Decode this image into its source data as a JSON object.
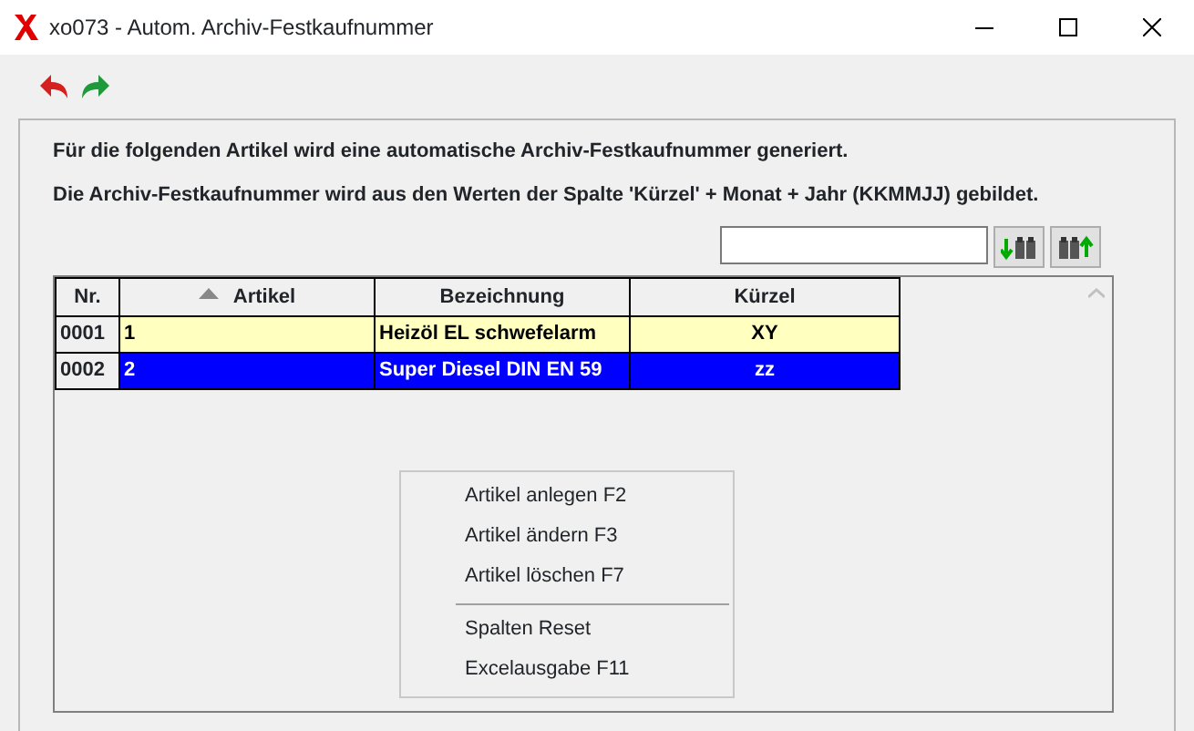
{
  "window": {
    "title": "xo073 - Autom. Archiv-Festkaufnummer"
  },
  "messages": [
    "Für die folgenden Artikel wird eine automatische Archiv-Festkaufnummer generiert.",
    "Die Archiv-Festkaufnummer wird aus den Werten der Spalte 'Kürzel' + Monat + Jahr (KKMMJJ) gebildet."
  ],
  "table": {
    "columns": [
      {
        "label": "Nr.",
        "sorted": false
      },
      {
        "label": "Artikel",
        "sorted": true
      },
      {
        "label": "Bezeichnung",
        "sorted": false
      },
      {
        "label": "Kürzel",
        "sorted": false
      }
    ],
    "rows": [
      {
        "selected": false,
        "cells": [
          "0001",
          "1",
          "Heizöl EL schwefelarm",
          "XY"
        ]
      },
      {
        "selected": true,
        "cells": [
          "0002",
          "2",
          "Super Diesel DIN EN 59",
          "zz"
        ]
      }
    ]
  },
  "context_menu": {
    "groups": [
      [
        "Artikel anlegen F2",
        "Artikel ändern F3",
        "Artikel löschen F7"
      ],
      [
        "Spalten Reset",
        "Excelausgabe F11"
      ]
    ]
  }
}
